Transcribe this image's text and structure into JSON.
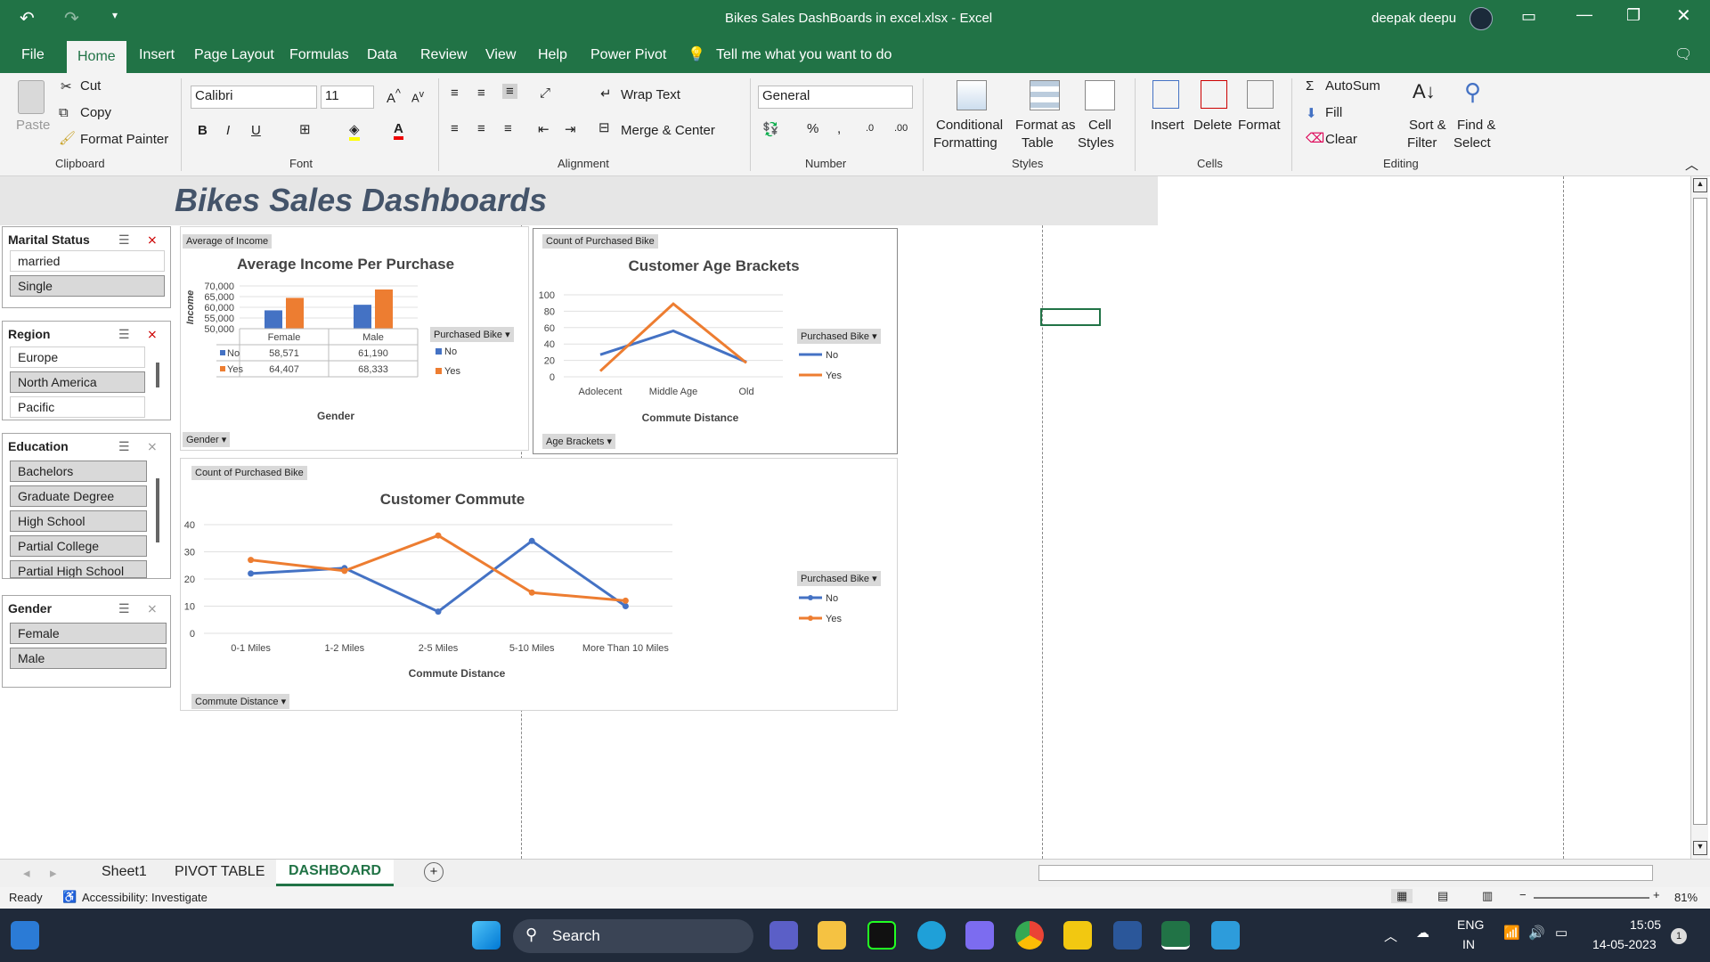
{
  "window": {
    "title": "Bikes Sales DashBoards in excel.xlsx  -  Excel",
    "user": "deepak deepu"
  },
  "menu": {
    "tabs": [
      "File",
      "Home",
      "Insert",
      "Page Layout",
      "Formulas",
      "Data",
      "Review",
      "View",
      "Help",
      "Power Pivot"
    ],
    "active": "Home",
    "tell_me": "Tell me what you want to do"
  },
  "ribbon": {
    "clipboard": {
      "paste": "Paste",
      "cut": "Cut",
      "copy": "Copy",
      "format_painter": "Format Painter",
      "label": "Clipboard"
    },
    "font": {
      "name": "Calibri",
      "size": "11",
      "label": "Font",
      "bold": "B",
      "italic": "I",
      "underline": "U"
    },
    "alignment": {
      "wrap": "Wrap Text",
      "merge": "Merge & Center",
      "label": "Alignment"
    },
    "number": {
      "format": "General",
      "label": "Number"
    },
    "styles": {
      "cond": "Conditional",
      "cond2": "Formatting",
      "table": "Format as",
      "table2": "Table",
      "cell": "Cell",
      "cell2": "Styles",
      "label": "Styles"
    },
    "cells": {
      "insert": "Insert",
      "delete": "Delete",
      "format": "Format",
      "label": "Cells"
    },
    "editing": {
      "autosum": "AutoSum",
      "fill": "Fill",
      "clear": "Clear",
      "sort": "Sort &",
      "sort2": "Filter",
      "find": "Find &",
      "find2": "Select",
      "label": "Editing"
    }
  },
  "dashboard": {
    "title": "Bikes Sales Dashboards",
    "slicers": {
      "marital": {
        "header": "Marital Status",
        "items": [
          "married",
          "Single"
        ]
      },
      "region": {
        "header": "Region",
        "items": [
          "Europe",
          "North America",
          "Pacific"
        ]
      },
      "education": {
        "header": "Education",
        "items": [
          "Bachelors",
          "Graduate Degree",
          "High School",
          "Partial College",
          "Partial High School"
        ]
      },
      "gender": {
        "header": "Gender",
        "items": [
          "Female",
          "Male"
        ]
      }
    },
    "income_chart": {
      "field_button": "Average of Income",
      "title": "Average Income Per Purchase",
      "ylabel": "Income",
      "xlabel": "Gender",
      "axis_button": "Gender",
      "legend_button": "Purchased Bike",
      "yticks": [
        "70,000",
        "65,000",
        "60,000",
        "55,000",
        "50,000"
      ],
      "table": {
        "cols": [
          "Female",
          "Male"
        ],
        "rows": [
          {
            "name": "No",
            "values": [
              "58,571",
              "61,190"
            ]
          },
          {
            "name": "Yes",
            "values": [
              "64,407",
              "68,333"
            ]
          }
        ]
      }
    },
    "age_chart": {
      "field_button": "Count of Purchased Bike",
      "title": "Customer Age Brackets",
      "xlabel": "Commute Distance",
      "axis_button": "Age Brackets",
      "legend_button": "Purchased Bike",
      "yticks": [
        "100",
        "80",
        "60",
        "40",
        "20",
        "0"
      ],
      "categories": [
        "Adolecent",
        "Middle Age",
        "Old"
      ]
    },
    "commute_chart": {
      "field_button": "Count of Purchased Bike",
      "title": "Customer Commute",
      "xlabel": "Commute Distance",
      "axis_button": "Commute Distance",
      "legend_button": "Purchased Bike",
      "yticks": [
        "40",
        "30",
        "20",
        "10",
        "0"
      ],
      "categories": [
        "0-1 Miles",
        "1-2 Miles",
        "2-5 Miles",
        "5-10 Miles",
        "More Than 10 Miles"
      ]
    },
    "legend": {
      "no": "No",
      "yes": "Yes"
    }
  },
  "chart_data": [
    {
      "type": "bar",
      "title": "Average Income Per Purchase",
      "xlabel": "Gender",
      "ylabel": "Income",
      "categories": [
        "Female",
        "Male"
      ],
      "ylim": [
        50000,
        70000
      ],
      "series": [
        {
          "name": "No",
          "values": [
            58571,
            61190
          ],
          "color": "#4472c4"
        },
        {
          "name": "Yes",
          "values": [
            64407,
            68333
          ],
          "color": "#ed7d31"
        }
      ]
    },
    {
      "type": "line",
      "title": "Customer Age Brackets",
      "xlabel": "Commute Distance",
      "categories": [
        "Adolecent",
        "Middle Age",
        "Old"
      ],
      "ylim": [
        0,
        100
      ],
      "series": [
        {
          "name": "No",
          "values": [
            27,
            56,
            18
          ],
          "color": "#4472c4"
        },
        {
          "name": "Yes",
          "values": [
            7,
            89,
            17
          ],
          "color": "#ed7d31"
        }
      ]
    },
    {
      "type": "line",
      "title": "Customer Commute",
      "xlabel": "Commute Distance",
      "categories": [
        "0-1 Miles",
        "1-2 Miles",
        "2-5 Miles",
        "5-10 Miles",
        "More Than 10 Miles"
      ],
      "ylim": [
        0,
        40
      ],
      "series": [
        {
          "name": "No",
          "values": [
            22,
            24,
            8,
            34,
            10
          ],
          "color": "#4472c4"
        },
        {
          "name": "Yes",
          "values": [
            27,
            23,
            36,
            15,
            12
          ],
          "color": "#ed7d31"
        }
      ]
    }
  ],
  "sheets": {
    "tabs": [
      "Sheet1",
      "PIVOT TABLE",
      "DASHBOARD"
    ],
    "active": "DASHBOARD"
  },
  "status": {
    "ready": "Ready",
    "accessibility": "Accessibility: Investigate",
    "zoom": "81%"
  },
  "taskbar": {
    "search": "Search",
    "lang1": "ENG",
    "lang2": "IN",
    "time": "15:05",
    "date": "14-05-2023"
  }
}
